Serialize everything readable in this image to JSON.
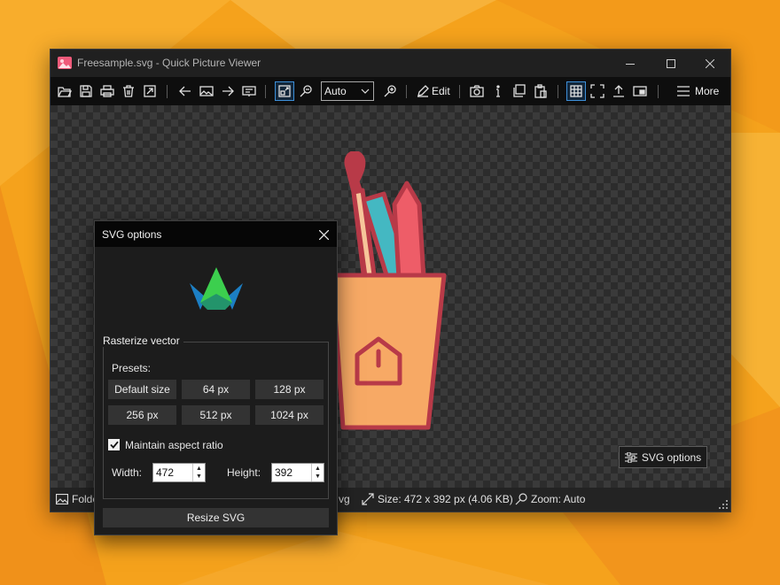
{
  "window": {
    "title": "Freesample.svg - Quick Picture Viewer"
  },
  "toolbar": {
    "zoom_value": "Auto",
    "edit_label": "Edit",
    "more_label": "More",
    "icons": [
      "open-folder-icon",
      "save-icon",
      "print-icon",
      "delete-icon",
      "set-wallpaper-icon",
      "previous-icon",
      "gallery-icon",
      "next-icon",
      "slideshow-icon",
      "autosize-icon",
      "zoom-out-icon",
      "zoom-in-icon",
      "edit-pen-icon",
      "screenshot-icon",
      "info-icon",
      "copy-icon",
      "paste-icon",
      "checkerboard-icon",
      "fullscreen-icon",
      "share-icon",
      "picture-in-picture-icon",
      "hamburger-menu-icon"
    ]
  },
  "canvas": {
    "svg_options_button": "SVG options"
  },
  "statusbar": {
    "folder_text": "Folde",
    "filename_tail": "vg",
    "size_text": "Size: 472 x 392 px (4.06 KB)",
    "zoom_text": "Zoom: Auto"
  },
  "dialog": {
    "title": "SVG options",
    "group_label": "Rasterize vector",
    "presets_label": "Presets:",
    "presets": [
      "Default size",
      "64 px",
      "128 px",
      "256 px",
      "512 px",
      "1024 px"
    ],
    "maintain_aspect_label": "Maintain aspect ratio",
    "maintain_aspect_checked": true,
    "width_label": "Width:",
    "width_value": "472",
    "height_label": "Height:",
    "height_value": "392",
    "resize_button": "Resize SVG"
  },
  "colors": {
    "accent": "#3d8fd8",
    "desktop": "#f5a21c",
    "cup": "#f7a965",
    "outline": "#b83a48"
  }
}
